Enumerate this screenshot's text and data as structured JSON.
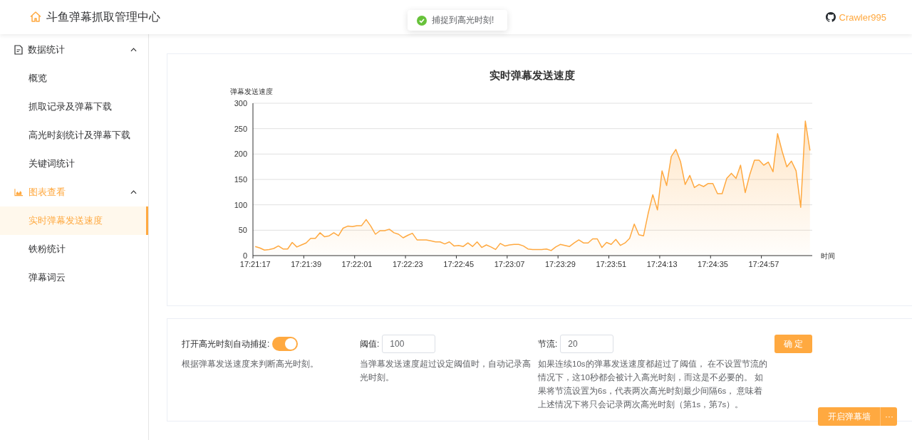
{
  "header": {
    "title": "斗鱼弹幕抓取管理中心",
    "github_user": "Crawler995"
  },
  "toast": {
    "kind": "success",
    "message": "捕捉到高光时刻!"
  },
  "sidebar": {
    "groups": [
      {
        "label": "数据统计",
        "expanded": true,
        "children": [
          {
            "label": "概览",
            "selected": false
          },
          {
            "label": "抓取记录及弹幕下载",
            "selected": false
          },
          {
            "label": "高光时刻统计及弹幕下载",
            "selected": false
          },
          {
            "label": "关键词统计",
            "selected": false
          }
        ]
      },
      {
        "label": "图表查看",
        "expanded": true,
        "children": [
          {
            "label": "实时弹幕发送速度",
            "selected": true
          },
          {
            "label": "铁粉统计",
            "selected": false
          },
          {
            "label": "弹幕词云",
            "selected": false
          }
        ]
      }
    ]
  },
  "chart": {
    "chart_data": {
      "type": "area",
      "title": "实时弹幕发送速度",
      "xlabel": "时间",
      "ylabel": "弹幕发送速度",
      "categories": [
        "17:21:17",
        null,
        null,
        null,
        null,
        null,
        null,
        null,
        null,
        null,
        null,
        "17:21:39",
        null,
        null,
        null,
        null,
        null,
        null,
        null,
        null,
        null,
        null,
        "17:22:01",
        null,
        null,
        null,
        null,
        null,
        null,
        null,
        null,
        null,
        null,
        "17:22:23",
        null,
        null,
        null,
        null,
        null,
        null,
        null,
        null,
        null,
        null,
        "17:22:45",
        null,
        null,
        null,
        null,
        null,
        null,
        null,
        null,
        null,
        null,
        "17:23:07",
        null,
        null,
        null,
        null,
        null,
        null,
        null,
        null,
        null,
        null,
        "17:23:29",
        null,
        null,
        null,
        null,
        null,
        null,
        null,
        null,
        null,
        null,
        "17:23:51",
        null,
        null,
        null,
        null,
        null,
        null,
        null,
        null,
        null,
        null,
        "17:24:13",
        null,
        null,
        null,
        null,
        null,
        null,
        null,
        null,
        null,
        null,
        "17:24:35",
        null,
        null,
        null,
        null,
        null,
        null,
        null,
        null,
        null,
        null,
        "17:24:57",
        null,
        null,
        null,
        null,
        null,
        null,
        null,
        null,
        null,
        null
      ],
      "series": [
        {
          "color": "#ffa940",
          "values": [
            18,
            15,
            11,
            12,
            14,
            19,
            13,
            13,
            26,
            17,
            21,
            25,
            34,
            34,
            45,
            37,
            39,
            45,
            39,
            54,
            58,
            57,
            59,
            59,
            71,
            58,
            42,
            49,
            49,
            52,
            45,
            42,
            35,
            40,
            44,
            31,
            31,
            31,
            29,
            27,
            27,
            23,
            27,
            19,
            20,
            18,
            25,
            18,
            27,
            16,
            21,
            17,
            12,
            24,
            19,
            21,
            22,
            22,
            19,
            13,
            12,
            12,
            12,
            13,
            10,
            17,
            22,
            20,
            18,
            25,
            31,
            25,
            25,
            33,
            33,
            16,
            26,
            22,
            32,
            20,
            25,
            34,
            62,
            41,
            39,
            83,
            120,
            90,
            167,
            138,
            195,
            209,
            185,
            140,
            158,
            134,
            140,
            136,
            142,
            142,
            122,
            122,
            152,
            162,
            152,
            178,
            124,
            160,
            188,
            188,
            178,
            184,
            165,
            240,
            205,
            175,
            186,
            167,
            95,
            265,
            207
          ]
        }
      ],
      "ylim": [
        0,
        300
      ],
      "yticks": [
        0,
        50,
        100,
        150,
        200,
        250,
        300
      ],
      "grid": true
    }
  },
  "settings": {
    "auto_capture": {
      "label": "打开高光时刻自动捕捉:",
      "on": true,
      "description": "根据弹幕发送速度来判断高光时刻。"
    },
    "threshold": {
      "label": "阈值:",
      "value": "100",
      "description": "当弹幕发送速度超过设定阈值时，自动记录高光时刻。"
    },
    "throttle": {
      "label": "节流:",
      "value": "20",
      "description": "如果连续10s的弹幕发送速度都超过了阈值， 在不设置节流的情况下，这10秒都会被计入高光时刻，而这是不必要的。 如果将节流设置为6s，代表两次高光时刻最少间隔6s， 意味着上述情况下将只会记录两次高光时刻（第1s，第7s）。"
    },
    "confirm": "确 定"
  },
  "danmaku_wall": {
    "button": "开启弹幕墙",
    "more": "···"
  }
}
